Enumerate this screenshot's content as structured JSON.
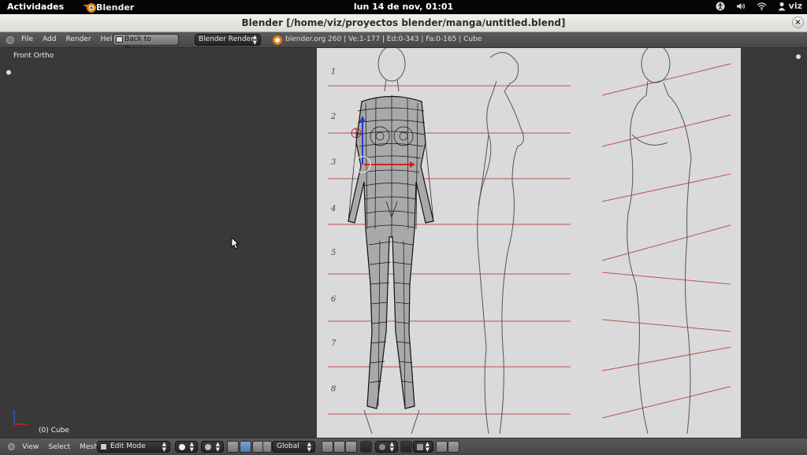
{
  "top_bar": {
    "activities": "Actividades",
    "app_name": "Blender",
    "clock": "lun 14 de nov, 01:01",
    "user": "viz",
    "tray_icons": [
      "accessibility-icon",
      "volume-icon",
      "wifi-icon",
      "user-icon"
    ]
  },
  "window": {
    "title": "Blender [/home/viz/proyectos blender/manga/untitled.blend]",
    "close_glyph": "×"
  },
  "info_header": {
    "menus": [
      "File",
      "Add",
      "Render",
      "Help"
    ],
    "back_button": "Back to Previous",
    "render_engine": "Blender Render",
    "stats": "blender.org 260 | Ve:1-177 | Ed:0-343 | Fa:0-165 | Cube"
  },
  "viewport": {
    "view_name": "Front Ortho",
    "active_object": "(0) Cube",
    "reference_image": {
      "row_labels": [
        "1",
        "2",
        "3",
        "4",
        "5",
        "6",
        "7",
        "8"
      ]
    },
    "colors": {
      "background": "#393939",
      "guide_lines": "#c0282a",
      "mesh_wire": "#111111"
    }
  },
  "view_header": {
    "menus": [
      "View",
      "Select",
      "Mesh"
    ],
    "mode": "Edit Mode",
    "transform_orientation": "Global"
  }
}
